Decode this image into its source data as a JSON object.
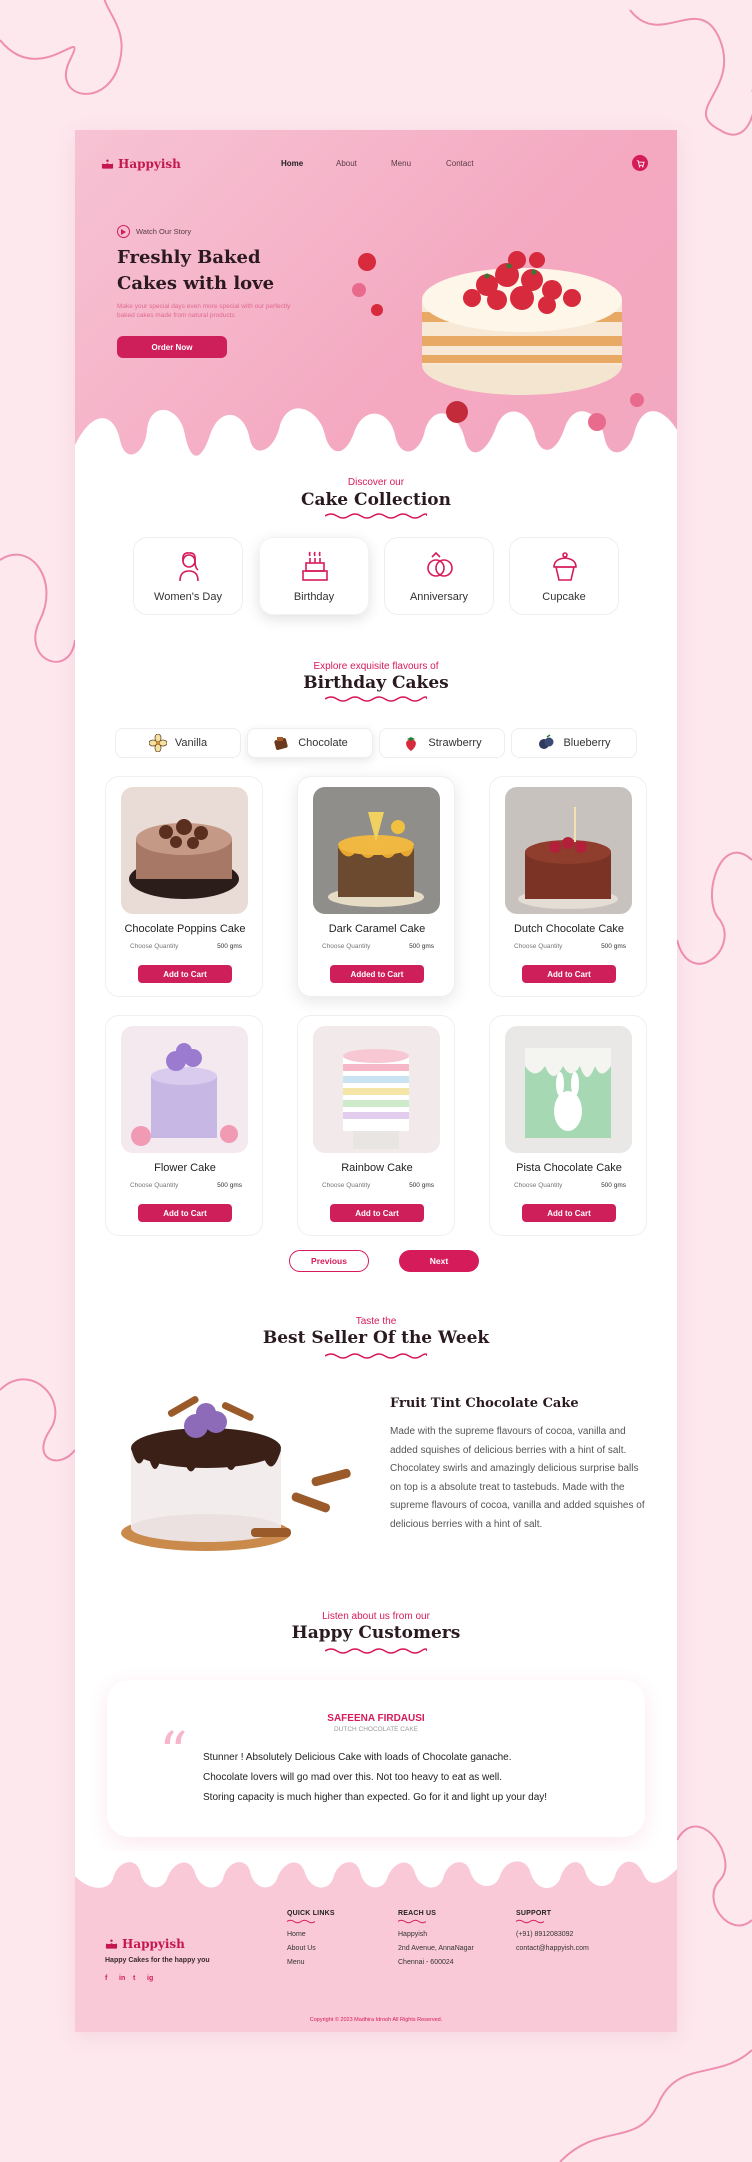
{
  "brand": {
    "name": "Happyish",
    "tagline": "Happy Cakes for the happy you"
  },
  "nav": {
    "items": [
      "Home",
      "About",
      "Menu",
      "Contact"
    ],
    "active": "Home"
  },
  "hero": {
    "watch_label": "Watch Our Story",
    "title_line1": "Freshly Baked",
    "title_line2": "Cakes with love",
    "subtitle": "Make your special days even more special with our perfectly baked cakes made from natural products",
    "cta": "Order Now"
  },
  "collection": {
    "kicker": "Discover our",
    "title": "Cake Collection",
    "categories": [
      "Women's Day",
      "Birthday",
      "Anniversary",
      "Cupcake"
    ],
    "selected": "Birthday"
  },
  "birthday": {
    "kicker": "Explore exquisite flavours of",
    "title": "Birthday Cakes",
    "flavours": [
      "Vanilla",
      "Chocolate",
      "Strawberry",
      "Blueberry"
    ],
    "selected_flavour": "Chocolate",
    "quantity_label": "Choose Quantity",
    "quantity_value": "500 gms",
    "cakes": [
      {
        "name": "Chocolate Poppins Cake",
        "button": "Add to Cart"
      },
      {
        "name": "Dark Caramel Cake",
        "button": "Added to Cart"
      },
      {
        "name": "Dutch Chocolate Cake",
        "button": "Add to Cart"
      },
      {
        "name": "Flower Cake",
        "button": "Add to Cart"
      },
      {
        "name": "Rainbow Cake",
        "button": "Add to Cart"
      },
      {
        "name": "Pista Chocolate Cake",
        "button": "Add to Cart"
      }
    ],
    "prev": "Previous",
    "next": "Next"
  },
  "bestseller": {
    "kicker": "Taste the",
    "title": "Best Seller Of the Week",
    "product": "Fruit Tint Chocolate Cake",
    "description": "Made with the supreme flavours of cocoa, vanilla and added squishes of delicious berries with a hint of salt. Chocolatey swirls and amazingly delicious surprise balls on top is a absolute treat to tastebuds. Made with the supreme flavours of cocoa, vanilla and added squishes of delicious berries with a hint of salt."
  },
  "customers": {
    "kicker": "Listen about us from our",
    "title": "Happy Customers",
    "name": "SAFEENA FIRDAUSI",
    "product": "DUTCH CHOCOLATE CAKE",
    "lines": [
      "Stunner ! Absolutely Delicious Cake with loads of Chocolate ganache.",
      "Chocolate lovers will go mad over this. Not too heavy to eat as well.",
      "Storing capacity is much higher than expected. Go for it and light up your day!"
    ]
  },
  "footer": {
    "quick_links": {
      "heading": "QUICK LINKS",
      "items": [
        "Home",
        "About Us",
        "Menu"
      ]
    },
    "reach_us": {
      "heading": "REACH US",
      "items": [
        "Happyish",
        "2nd Avenue, AnnaNagar",
        "Chennai - 600024"
      ]
    },
    "support": {
      "heading": "SUPPORT",
      "items": [
        "(+91)  8912083092",
        "contact@happyish.com"
      ]
    },
    "social": [
      "f",
      "in",
      "t",
      "ig"
    ],
    "copyright": "Copyright  ©  2023  Madhira Idrooh  All Rights Reserved."
  },
  "colors": {
    "accent": "#d61b5a",
    "hero_pink": "#f4a9c1",
    "footer_pink": "#f9c9d8",
    "bg": "#fde8ee"
  }
}
